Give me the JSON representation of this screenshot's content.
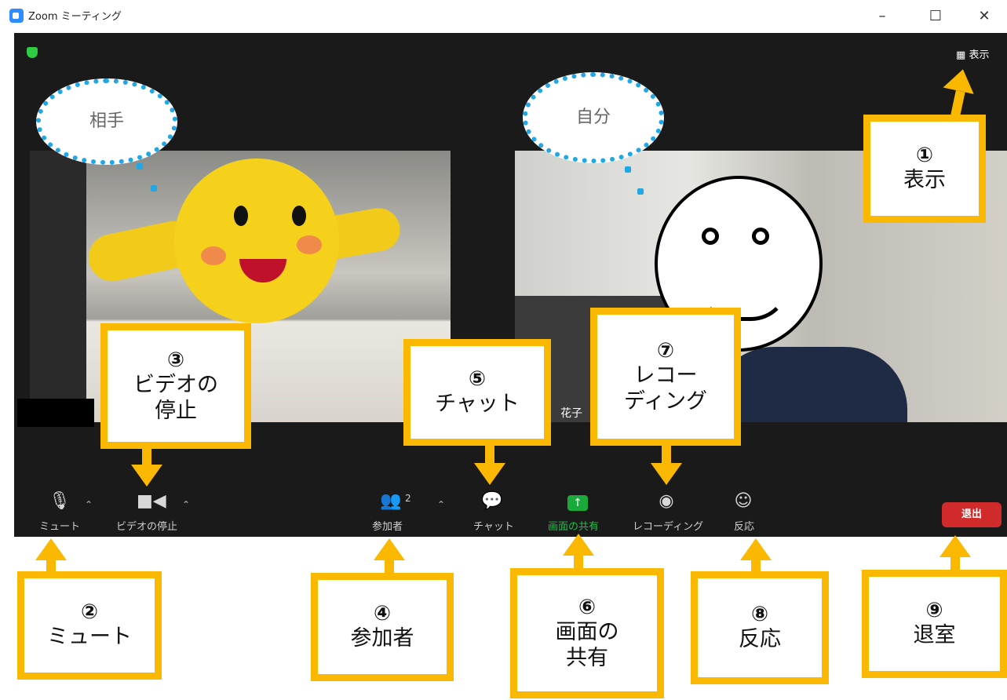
{
  "window": {
    "title": "Zoom ミーティング",
    "minimize_glyph": "–",
    "maximize_glyph": "☐",
    "close_glyph": "✕"
  },
  "top": {
    "view_label": "表示",
    "view_icon": "grid-icon"
  },
  "participants": {
    "self_name": "花子"
  },
  "bubbles": {
    "other": "相手",
    "self": "自分"
  },
  "toolbar": {
    "mute": "ミュート",
    "video_stop": "ビデオの停止",
    "participants": "参加者",
    "participants_count": "2",
    "chat": "チャット",
    "share": "画面の共有",
    "record": "レコーディング",
    "reactions": "反応",
    "leave": "退出",
    "share_color": "#1aaa3c",
    "leave_color": "#d12a2a"
  },
  "annotations": [
    {
      "num": "①",
      "lines": [
        "表示"
      ]
    },
    {
      "num": "②",
      "lines": [
        "ミュート"
      ]
    },
    {
      "num": "③",
      "lines": [
        "ビデオの",
        "停止"
      ]
    },
    {
      "num": "④",
      "lines": [
        "参加者"
      ]
    },
    {
      "num": "⑤",
      "lines": [
        "チャット"
      ]
    },
    {
      "num": "⑥",
      "lines": [
        "画面の",
        "共有"
      ]
    },
    {
      "num": "⑦",
      "lines": [
        "レコー",
        "ディング"
      ]
    },
    {
      "num": "⑧",
      "lines": [
        "反応"
      ]
    },
    {
      "num": "⑨",
      "lines": [
        "退室"
      ]
    }
  ],
  "colors": {
    "annotation_border": "#fbb800",
    "bubble_border": "#1fa7e6"
  }
}
